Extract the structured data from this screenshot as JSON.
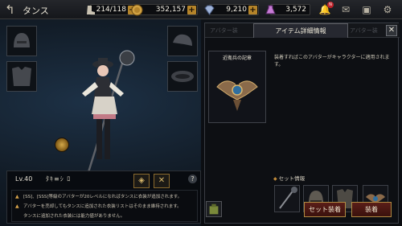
{
  "header": {
    "title": "タンス",
    "stamina": "214/118",
    "gold": "352,157",
    "gems": "9,210",
    "points": "3,572",
    "notification_count": "N"
  },
  "character": {
    "level": "Lv.40",
    "name": "ﾀｷ≡ｼ ﾛ"
  },
  "notes": [
    "[SS]、[SSS]等級のアバターが20レベルになればタンスに衣装が追加されます。",
    "アバターを売却してもタンスに追加された衣装リストはそのまま維持されます。",
    "タンスに追加された衣装には能力値がありません。"
  ],
  "panel": {
    "title": "アイテム詳細情報",
    "ghost_tab_left": "アバター装",
    "ghost_tab_right": "アバター装",
    "item_name": "近衛兵の記章",
    "description": "装着すればこのアバターがキャラクターに適用されます。",
    "set_title": "セット情報",
    "btn_set_equip": "セット装着",
    "btn_equip": "装着"
  },
  "colors": {
    "accent_gold": "#b5842a",
    "button_red": "#5a1e18"
  }
}
